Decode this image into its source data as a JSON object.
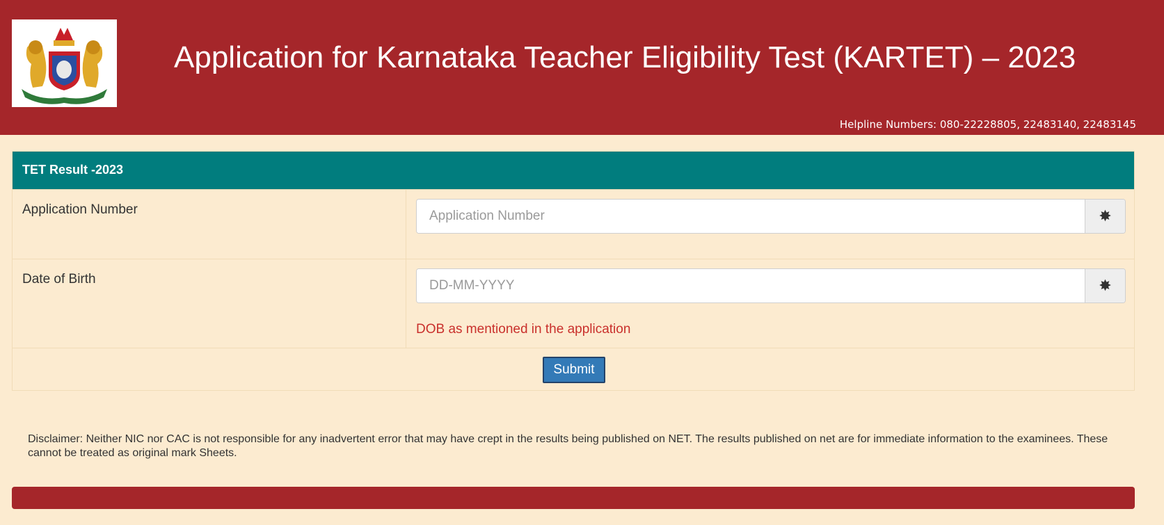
{
  "header": {
    "title": "Application for Karnataka Teacher Eligibility Test (KARTET) – 2023",
    "helpline": "Helpline Numbers: 080-22228805, 22483140, 22483145",
    "logo_icon": "karnataka-emblem-icon"
  },
  "form": {
    "heading": "TET Result -2023",
    "application_number": {
      "label": "Application Number",
      "placeholder": "Application Number",
      "value": "",
      "addon_icon": "asterisk-icon"
    },
    "dob": {
      "label": "Date of Birth",
      "placeholder": "DD-MM-YYYY",
      "value": "",
      "addon_icon": "asterisk-icon",
      "hint": "DOB as mentioned in the application"
    },
    "submit_label": "Submit"
  },
  "disclaimer": "Disclaimer: Neither NIC nor CAC is not responsible for any inadvertent error that may have crept in the results being published on NET. The results published on net are for immediate information to the examinees. These cannot be treated as original mark Sheets.",
  "colors": {
    "header_bg": "#a5262a",
    "panel_heading_bg": "#017d7e",
    "page_bg": "#fcebd0",
    "submit_bg": "#337ab7",
    "hint_text": "#c9302c"
  }
}
